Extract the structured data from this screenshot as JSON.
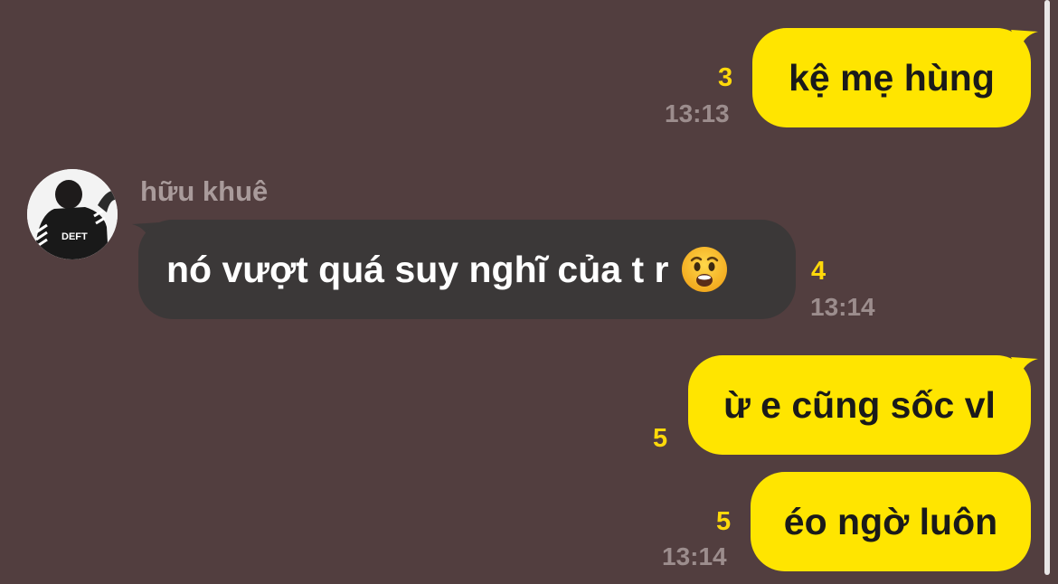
{
  "messages": [
    {
      "text": "kệ mẹ hùng",
      "unread": "3",
      "time": "13:13"
    },
    {
      "sender": "hữu khuê",
      "text": "nó vượt quá suy nghĩ của t r",
      "emoji": "anguished-face-emoji",
      "unread": "4",
      "time": "13:14"
    },
    {
      "text": "ừ e cũng sốc vl",
      "unread": "5"
    },
    {
      "text": "éo ngờ luôn",
      "unread": "5",
      "time": "13:14"
    }
  ],
  "avatar": {
    "shirt_text": "DEFT"
  },
  "colors": {
    "background": "#523e3f",
    "outgoing_bubble": "#ffe500",
    "incoming_bubble": "#3b3838",
    "unread_count": "#ffd90a",
    "timestamp": "#9c8d8d"
  }
}
